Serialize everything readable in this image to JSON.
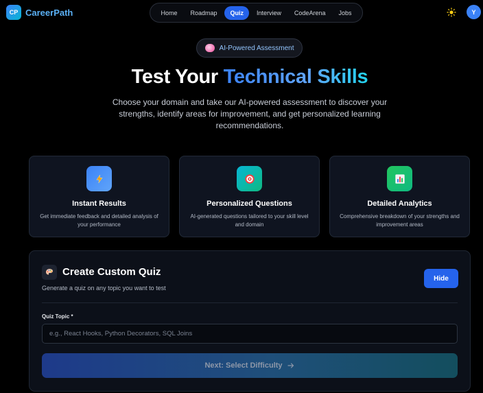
{
  "brand": {
    "badge": "CP",
    "name": "CareerPath"
  },
  "nav": {
    "items": [
      {
        "label": "Home",
        "active": false
      },
      {
        "label": "Roadmap",
        "active": false
      },
      {
        "label": "Quiz",
        "active": true
      },
      {
        "label": "Interview",
        "active": false
      },
      {
        "label": "CodeArena",
        "active": false
      },
      {
        "label": "Jobs",
        "active": false
      }
    ]
  },
  "header": {
    "theme_icon": "sun-icon",
    "avatar_initial": "Y"
  },
  "hero": {
    "pill_icon": "brain-icon",
    "pill_text": "AI-Powered Assessment",
    "title_plain": "Test Your ",
    "title_accent": "Technical Skills",
    "subtitle": "Choose your domain and take our AI-powered assessment to discover your strengths, identify areas for improvement, and get personalized learning recommendations."
  },
  "features": [
    {
      "icon": "lightning-icon",
      "title": "Instant Results",
      "description": "Get immediate feedback and detailed analysis of your performance",
      "color": "#3b82f6"
    },
    {
      "icon": "target-icon",
      "title": "Personalized Questions",
      "description": "AI-generated questions tailored to your skill level and domain",
      "color": "#14b8a6"
    },
    {
      "icon": "chart-icon",
      "title": "Detailed Analytics",
      "description": "Comprehensive breakdown of your strengths and improvement areas",
      "color": "#22c55e"
    }
  ],
  "custom_quiz": {
    "icon": "palette-icon",
    "title": "Create Custom Quiz",
    "subtitle": "Generate a quiz on any topic you want to test",
    "hide_label": "Hide",
    "topic_label": "Quiz Topic *",
    "topic_value": "",
    "topic_placeholder": "e.g., React Hooks, Python Decorators, SQL Joins",
    "next_label": "Next: Select Difficulty"
  },
  "colors": {
    "accent": "#2563eb",
    "brand": "#5ab0f5",
    "background": "#000000",
    "card": "#0f1420"
  }
}
